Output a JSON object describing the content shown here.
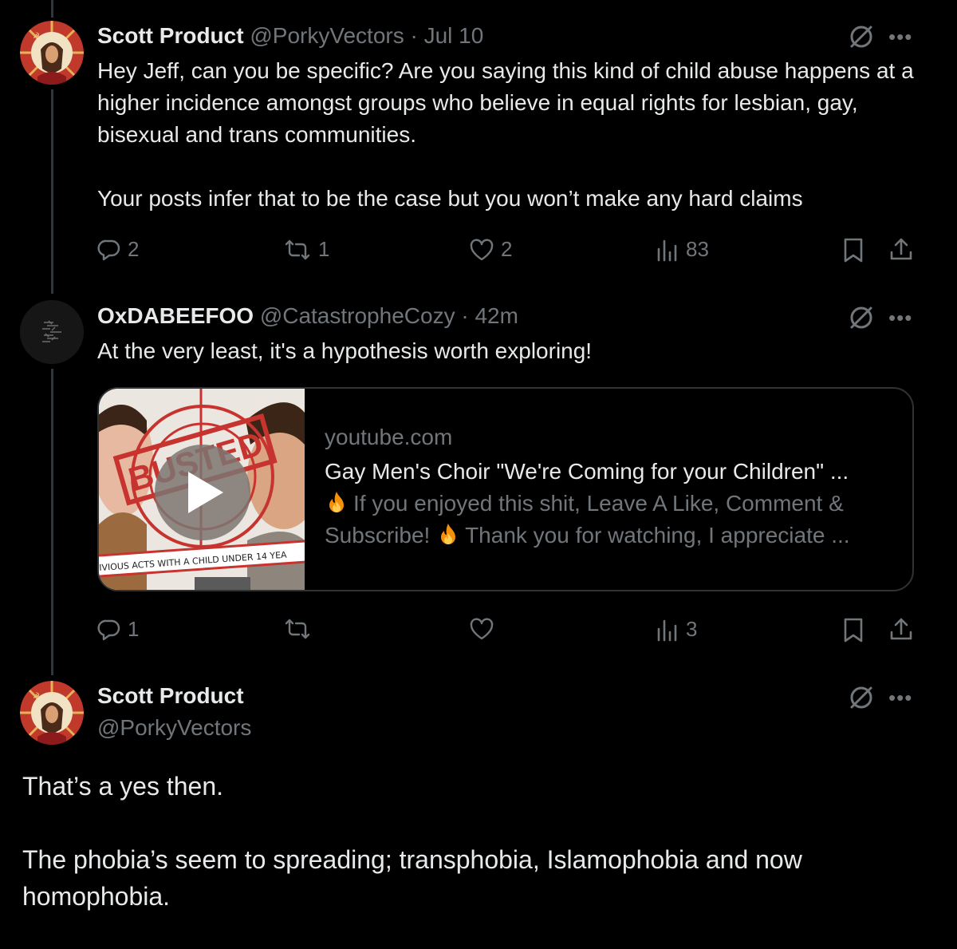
{
  "tweets": [
    {
      "name": "Scott Product",
      "handle": "@PorkyVectors",
      "time": "· Jul 10",
      "text": "Hey Jeff, can you be specific? Are you saying this kind of child abuse happens at a higher incidence amongst groups who believe in equal rights for lesbian, gay, bisexual and trans communities.\n\nYour posts infer that to be the case but you won’t make any hard  claims",
      "replies": "2",
      "reposts": "1",
      "likes": "2",
      "views": "83"
    },
    {
      "name": "OxDABEEFOO",
      "handle": "@CatastropheCozy",
      "time": "· 42m",
      "text": "At the very least, it's a hypothesis worth exploring!",
      "card": {
        "domain": "youtube.com",
        "title": "Gay Men's Choir \"We're Coming for your Children\" ...",
        "desc_part1": "If you enjoyed this shit, Leave A Like, Comment &",
        "desc_part2": "Subscribe!",
        "desc_part3": "Thank you for watching, I appreciate ...",
        "thumb_stamp": "BUSTED",
        "thumb_banner": "IVIOUS ACTS WITH A CHILD UNDER 14 YEA"
      },
      "replies": "1",
      "reposts": "",
      "likes": "",
      "views": "3"
    }
  ],
  "main": {
    "name": "Scott Product",
    "handle": "@PorkyVectors",
    "text": "That’s a yes then.\n\nThe phobia’s seem to spreading; transphobia, Islamophobia and now homophobia."
  },
  "icons": {
    "grok": "grok-icon",
    "more": "more-icon",
    "reply": "reply-icon",
    "repost": "repost-icon",
    "like": "like-icon",
    "views": "views-icon",
    "bookmark": "bookmark-icon",
    "share": "share-icon"
  },
  "colors": {
    "background": "#000000",
    "text": "#e7e9ea",
    "muted": "#71767b",
    "border": "#2f3336"
  }
}
